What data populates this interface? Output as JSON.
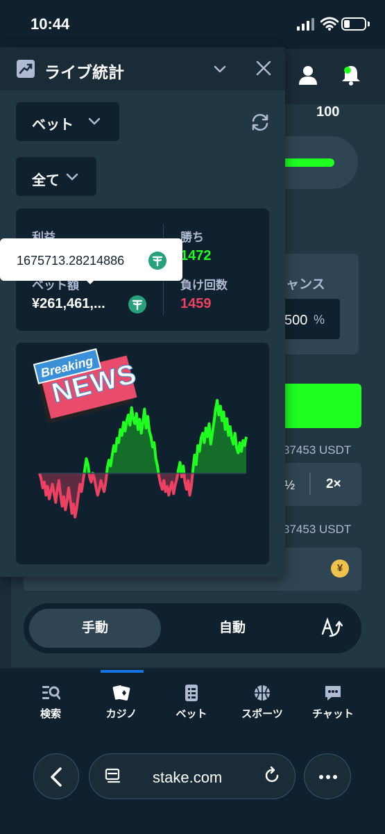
{
  "status_bar": {
    "time": "10:44"
  },
  "game": {
    "slider_max": "100",
    "win_chance_label": "ャンス",
    "win_chance_value": "500",
    "win_chance_unit": "%",
    "usdt_balance_1": "37453 USDT",
    "half_label": "½",
    "double_label": "2×",
    "usdt_balance_2": "37453 USDT",
    "currency_symbol": "¥",
    "modes": {
      "manual": "手動",
      "auto": "自動"
    }
  },
  "live_stats": {
    "title": "ライブ統計",
    "bet_filter": "ベット",
    "range_filter": "全て",
    "profit_label": "利益",
    "profit_tooltip": "1675713.28214886",
    "wins_label": "勝ち",
    "wins_value": "1472",
    "wager_label": "ベット額",
    "wager_value": "¥261,461,...",
    "losses_label": "負け回数",
    "losses_value": "1459",
    "overlay": {
      "breaking": "Breaking",
      "news": "NEWS"
    }
  },
  "chart_data": {
    "type": "area",
    "baseline": 0,
    "colors": {
      "positive": "#1fff20",
      "negative": "#ed4163"
    },
    "values": [
      0,
      -8,
      -20,
      -12,
      -30,
      -18,
      -35,
      -25,
      -15,
      -28,
      -40,
      -22,
      -10,
      -30,
      -45,
      -32,
      -50,
      -38,
      -20,
      -35,
      -55,
      -42,
      -60,
      -48,
      -30,
      -15,
      -25,
      -10,
      5,
      20,
      12,
      -5,
      -12,
      0,
      -8,
      -20,
      -30,
      -22,
      -10,
      -18,
      -25,
      -12,
      8,
      18,
      10,
      25,
      38,
      30,
      48,
      42,
      60,
      52,
      70,
      58,
      72,
      80,
      66,
      90,
      75,
      68,
      82,
      60,
      74,
      55,
      70,
      88,
      62,
      78,
      58,
      50,
      36,
      42,
      20,
      10,
      -5,
      -15,
      -22,
      -10,
      -25,
      -18,
      -30,
      -20,
      -12,
      -28,
      -16,
      -8,
      5,
      15,
      -5,
      10,
      -12,
      -22,
      -10,
      -30,
      -18,
      5,
      25,
      12,
      38,
      30,
      48,
      55,
      42,
      62,
      50,
      68,
      40,
      55,
      70,
      88,
      100,
      80,
      92,
      72,
      84,
      60,
      75,
      52,
      64,
      48,
      40,
      55,
      35,
      28,
      42,
      30,
      45,
      38,
      50
    ]
  },
  "nav": {
    "items": [
      {
        "label": "検索"
      },
      {
        "label": "カジノ"
      },
      {
        "label": "ベット"
      },
      {
        "label": "スポーツ"
      },
      {
        "label": "チャット"
      }
    ]
  },
  "browser": {
    "url": "stake.com"
  }
}
